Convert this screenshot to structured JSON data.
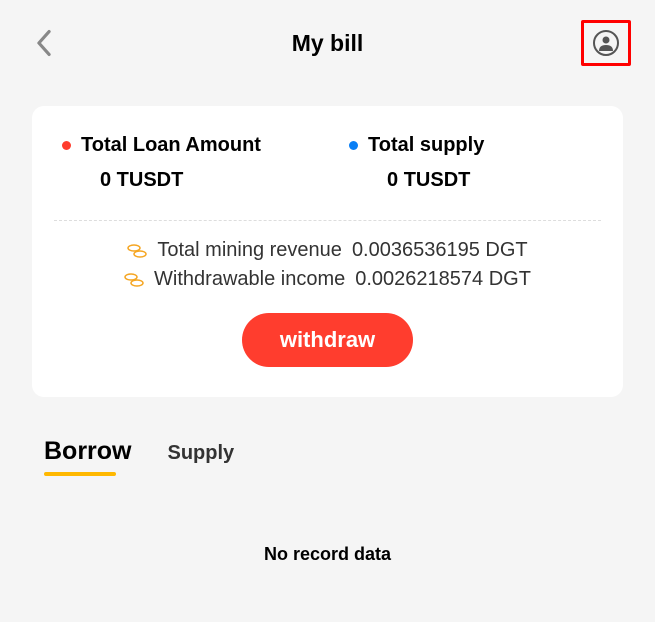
{
  "header": {
    "title": "My bill"
  },
  "card": {
    "loan": {
      "label": "Total Loan Amount",
      "value": "0 TUSDT"
    },
    "supply": {
      "label": "Total supply",
      "value": "0 TUSDT"
    },
    "revenue": {
      "mining_label": "Total mining revenue",
      "mining_value": "0.0036536195 DGT",
      "withdrawable_label": "Withdrawable income",
      "withdrawable_value": "0.0026218574 DGT"
    },
    "withdraw_label": "withdraw"
  },
  "tabs": {
    "borrow": "Borrow",
    "supply": "Supply"
  },
  "empty": {
    "text": "No record data"
  }
}
